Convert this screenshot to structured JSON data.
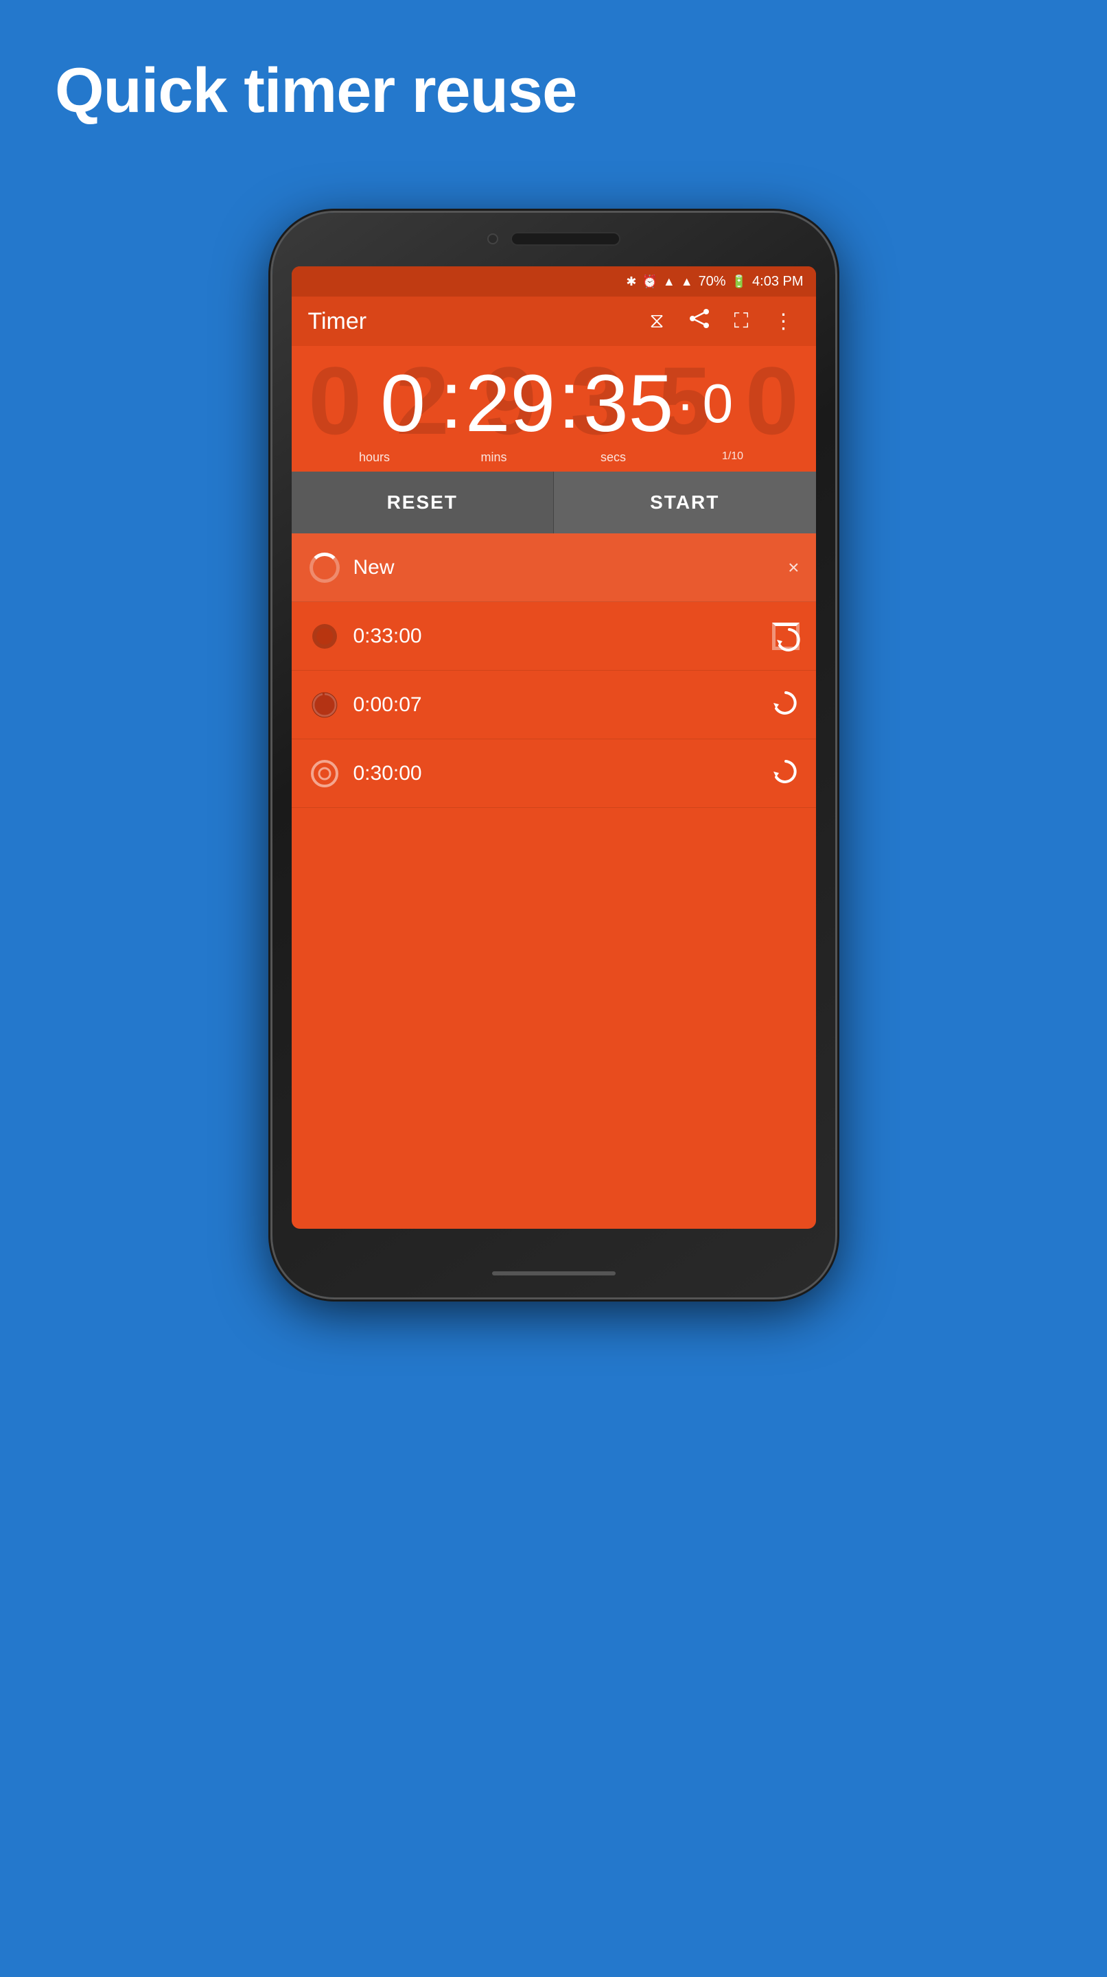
{
  "page": {
    "title": "Quick timer reuse",
    "background_color": "#2478CC"
  },
  "status_bar": {
    "battery": "70%",
    "time": "4:03 PM"
  },
  "toolbar": {
    "title": "Timer"
  },
  "timer": {
    "hours": "0",
    "minutes": "29",
    "seconds": "35",
    "tenths": "0",
    "label_hours": "hours",
    "label_mins": "mins",
    "label_secs": "secs",
    "label_tenths": "1/10"
  },
  "buttons": {
    "reset": "RESET",
    "start": "START"
  },
  "timer_list": {
    "items": [
      {
        "label": "New",
        "action": "×",
        "icon_type": "spinning"
      },
      {
        "label": "0:33:00",
        "action": "reload",
        "icon_type": "circle_full"
      },
      {
        "label": "0:00:07",
        "action": "reload",
        "icon_type": "circle_partial"
      },
      {
        "label": "0:30:00",
        "action": "reload",
        "icon_type": "circle_outline"
      }
    ]
  }
}
